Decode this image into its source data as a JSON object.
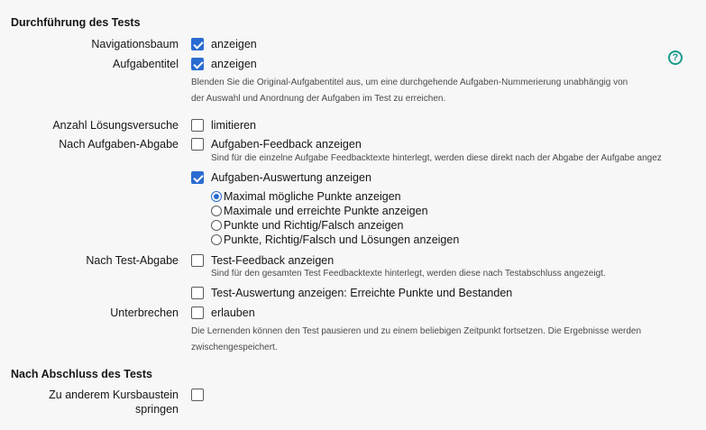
{
  "sections": {
    "durchfuehrung": "Durchführung des Tests",
    "abschluss": "Nach Abschluss des Tests"
  },
  "rows": {
    "navigationsbaum": {
      "label": "Navigationsbaum",
      "option": "anzeigen",
      "checked": true
    },
    "aufgabentitel": {
      "label": "Aufgabentitel",
      "option": "anzeigen",
      "checked": true,
      "help_line1": "Blenden Sie die Original-Aufgabentitel aus, um eine durchgehende Aufgaben-Nummerierung unabhängig von",
      "help_line2": "der Auswahl und Anordnung der Aufgaben im Test zu erreichen."
    },
    "loesungsversuche": {
      "label": "Anzahl Lösungsversuche",
      "option": "limitieren",
      "checked": false
    },
    "aufgaben_abgabe": {
      "label": "Nach Aufgaben-Abgabe",
      "feedback_option": "Aufgaben-Feedback anzeigen",
      "feedback_checked": false,
      "feedback_help": "Sind für die einzelne Aufgabe Feedbacktexte hinterlegt, werden diese direkt nach der Abgabe der Aufgabe angez",
      "auswertung_option": "Aufgaben-Auswertung anzeigen",
      "auswertung_checked": true,
      "radios": [
        {
          "label": "Maximal mögliche Punkte anzeigen",
          "selected": true
        },
        {
          "label": "Maximale und erreichte Punkte anzeigen",
          "selected": false
        },
        {
          "label": "Punkte und Richtig/Falsch anzeigen",
          "selected": false
        },
        {
          "label": "Punkte, Richtig/Falsch und Lösungen anzeigen",
          "selected": false
        }
      ]
    },
    "test_abgabe": {
      "label": "Nach Test-Abgabe",
      "feedback_option": "Test-Feedback anzeigen",
      "feedback_checked": false,
      "feedback_help": "Sind für den gesamten Test Feedbacktexte hinterlegt, werden diese nach Testabschluss angezeigt.",
      "auswertung_option": "Test-Auswertung anzeigen: Erreichte Punkte und Bestanden",
      "auswertung_checked": false
    },
    "unterbrechen": {
      "label": "Unterbrechen",
      "option": "erlauben",
      "checked": false,
      "help_line1": "Die Lernenden können den Test pausieren und zu einem beliebigen Zeitpunkt fortsetzen. Die Ergebnisse werden",
      "help_line2": "zwischengespeichert."
    },
    "kursbaustein": {
      "label_line1": "Zu anderem Kursbaustein",
      "label_line2": "springen",
      "checked": false
    }
  },
  "help_icon": {
    "name": "help-icon",
    "glyph": "?",
    "color": "#1a9a8a"
  },
  "colors": {
    "accent": "#2a6bd1",
    "background": "#f7f7f7"
  }
}
